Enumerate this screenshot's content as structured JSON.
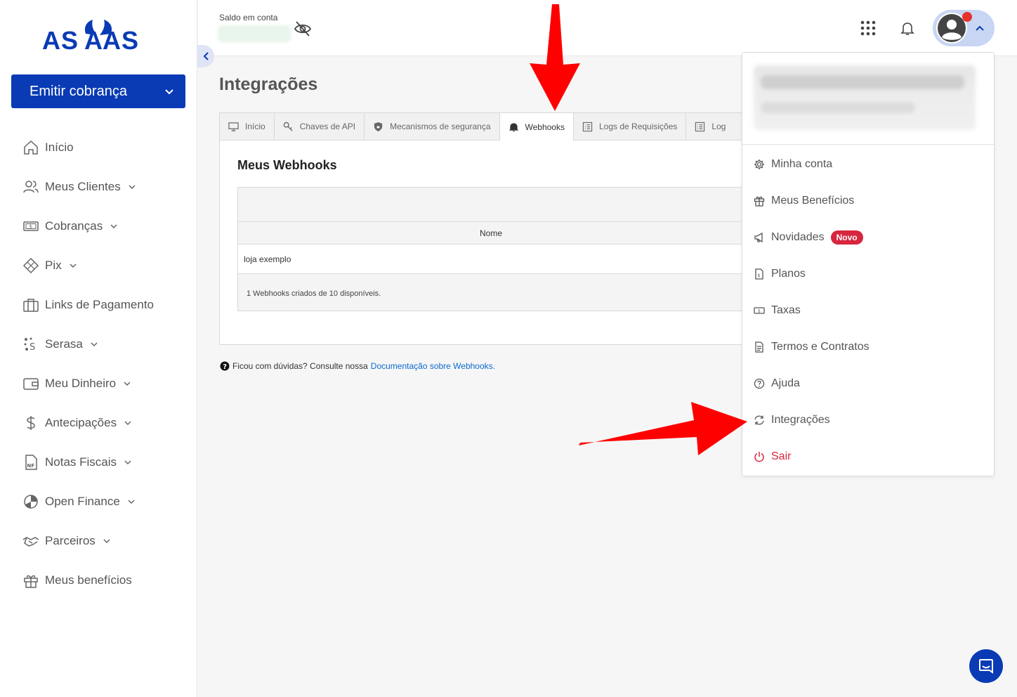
{
  "brand": {
    "logo_text": "ASAAS",
    "primary_color": "#0a3bb5",
    "danger_color": "#d7263d"
  },
  "sidebar": {
    "emit_button_label": "Emitir cobrança",
    "items": [
      {
        "label": "Início",
        "icon": "home-icon"
      },
      {
        "label": "Meus Clientes",
        "icon": "users-icon"
      },
      {
        "label": "Cobranças",
        "icon": "money-icon"
      },
      {
        "label": "Pix",
        "icon": "pix-icon"
      },
      {
        "label": "Links de Pagamento",
        "icon": "briefcase-icon"
      },
      {
        "label": "Serasa",
        "icon": "serasa-icon"
      },
      {
        "label": "Meu Dinheiro",
        "icon": "wallet-icon"
      },
      {
        "label": "Antecipações",
        "icon": "dollar-icon"
      },
      {
        "label": "Notas Fiscais",
        "icon": "invoice-icon"
      },
      {
        "label": "Open Finance",
        "icon": "pie-icon"
      },
      {
        "label": "Parceiros",
        "icon": "handshake-icon"
      },
      {
        "label": "Meus benefícios",
        "icon": "gift-icon"
      }
    ]
  },
  "header": {
    "balance_label": "Saldo em conta"
  },
  "main": {
    "page_title": "Integrações",
    "tabs": [
      {
        "label": "Início",
        "icon": "monitor-icon"
      },
      {
        "label": "Chaves de API",
        "icon": "key-icon"
      },
      {
        "label": "Mecanismos de segurança",
        "icon": "shield-icon"
      },
      {
        "label": "Webhooks",
        "icon": "bell-icon",
        "active": true
      },
      {
        "label": "Logs de Requisições",
        "icon": "list-icon"
      },
      {
        "label": "Log",
        "icon": "list-icon"
      }
    ],
    "section_title": "Meus Webhooks",
    "table": {
      "column_name": "Nome",
      "rows": [
        {
          "name": "loja exemplo"
        }
      ],
      "footer": "1 Webhooks criados de 10 disponíveis."
    },
    "help_text": "Ficou com dúvidas? Consulte nossa",
    "help_link": "Documentação sobre Webhooks."
  },
  "user_menu": {
    "items": [
      {
        "label": "Minha conta",
        "icon": "gear-icon"
      },
      {
        "label": "Meus Benefícios",
        "icon": "gift-icon"
      },
      {
        "label": "Novidades",
        "icon": "megaphone-icon",
        "badge": "Novo"
      },
      {
        "label": "Planos",
        "icon": "document-icon"
      },
      {
        "label": "Taxas",
        "icon": "money-icon"
      },
      {
        "label": "Termos e Contratos",
        "icon": "document-icon"
      },
      {
        "label": "Ajuda",
        "icon": "help-icon"
      },
      {
        "label": "Integrações",
        "icon": "sync-icon"
      },
      {
        "label": "Sair",
        "icon": "power-icon"
      }
    ]
  }
}
